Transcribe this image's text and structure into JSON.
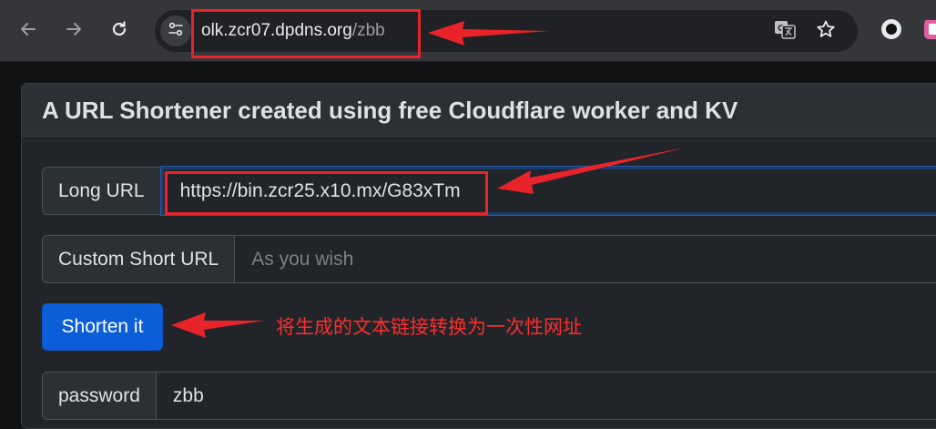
{
  "browser": {
    "url_host": "olk.zcr07.dpdns.org",
    "url_path": "/zbb",
    "icons": {
      "back": "back-arrow-icon",
      "forward": "forward-arrow-icon",
      "reload": "reload-icon",
      "site_info": "site-settings-icon",
      "translate": "translate-icon",
      "bookmark": "star-icon",
      "extension_1": "circle-extension-icon",
      "extension_2": "pink-extension-icon"
    }
  },
  "page": {
    "title": "A URL Shortener created using free Cloudflare worker and KV",
    "long_url": {
      "label": "Long URL",
      "value": "https://bin.zcr25.x10.mx/G83xTm"
    },
    "custom_short_url": {
      "label": "Custom Short URL",
      "placeholder": "As you wish"
    },
    "shorten_button": "Shorten it",
    "password": {
      "label": "password",
      "value": "zbb"
    }
  },
  "annotations": {
    "note_text": "将生成的文本链接转换为一次性网址",
    "color": "#e8232a"
  }
}
